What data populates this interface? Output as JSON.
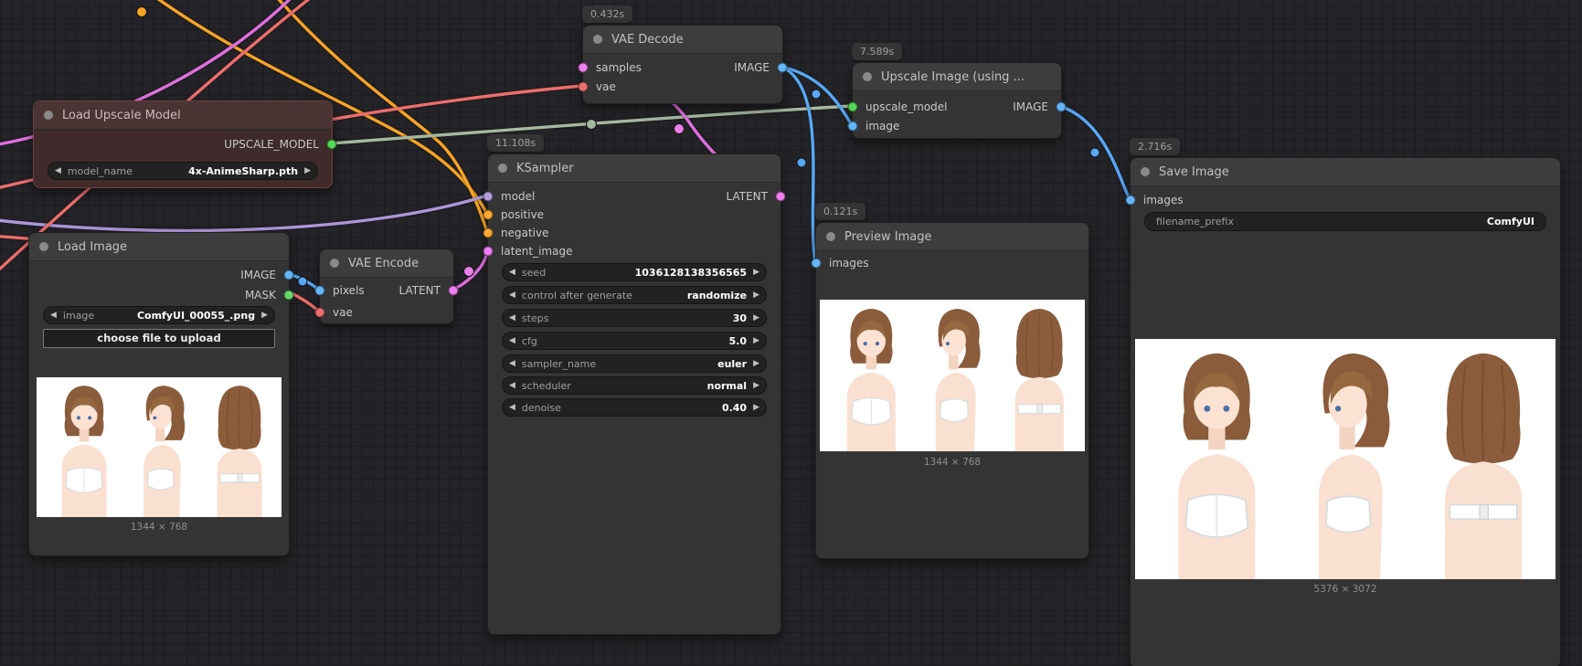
{
  "app": {
    "name": "ComfyUI",
    "view": "node-graph"
  },
  "colors": {
    "canvas_bg": "#242428",
    "grid_line": "#1d1d20",
    "node_bg": "#343434",
    "node_header_bg": "#3d3d3d",
    "red_node_bg": "#3f2b2b",
    "red_node_header_bg": "#4a3434",
    "image_link": "#64b5f6",
    "mask_link": "#66d96b",
    "latent_link": "#ee7ff1",
    "vae_link": "#ed6d6d",
    "model_link": "#b39ddb",
    "conditioning_link": "#ffa931",
    "upscale_model_dot": "#57d657",
    "upscale_model_wire": "#a6b8a1"
  },
  "nodes": {
    "load_upscale_model": {
      "title": "Load Upscale Model",
      "outputs": [
        {
          "name": "UPSCALE_MODEL"
        }
      ],
      "widgets": [
        {
          "name": "model_name",
          "value": "4x-AnimeSharp.pth"
        }
      ]
    },
    "load_image": {
      "title": "Load Image",
      "outputs": [
        {
          "name": "IMAGE"
        },
        {
          "name": "MASK"
        }
      ],
      "widgets": [
        {
          "name": "image",
          "value": "ComfyUI_00055_.png"
        }
      ],
      "button": "choose file to upload",
      "caption": "1344 × 768"
    },
    "vae_encode": {
      "title": "VAE Encode",
      "inputs": [
        {
          "name": "pixels"
        },
        {
          "name": "vae"
        }
      ],
      "outputs": [
        {
          "name": "LATENT"
        }
      ]
    },
    "ksampler": {
      "badge": "11.108s",
      "title": "KSampler",
      "inputs": [
        {
          "name": "model"
        },
        {
          "name": "positive"
        },
        {
          "name": "negative"
        },
        {
          "name": "latent_image"
        }
      ],
      "outputs": [
        {
          "name": "LATENT"
        }
      ],
      "widgets": [
        {
          "name": "seed",
          "value": "1036128138356565"
        },
        {
          "name": "control after generate",
          "value": "randomize"
        },
        {
          "name": "steps",
          "value": "30"
        },
        {
          "name": "cfg",
          "value": "5.0"
        },
        {
          "name": "sampler_name",
          "value": "euler"
        },
        {
          "name": "scheduler",
          "value": "normal"
        },
        {
          "name": "denoise",
          "value": "0.40"
        }
      ]
    },
    "vae_decode": {
      "badge": "0.432s",
      "title": "VAE Decode",
      "inputs": [
        {
          "name": "samples"
        },
        {
          "name": "vae"
        }
      ],
      "outputs": [
        {
          "name": "IMAGE"
        }
      ]
    },
    "upscale_image": {
      "badge": "7.589s",
      "title": "Upscale Image (using ...",
      "inputs": [
        {
          "name": "upscale_model"
        },
        {
          "name": "image"
        }
      ],
      "outputs": [
        {
          "name": "IMAGE"
        }
      ]
    },
    "preview_image": {
      "badge": "0.121s",
      "title": "Preview Image",
      "inputs": [
        {
          "name": "images"
        }
      ],
      "caption": "1344 × 768"
    },
    "save_image": {
      "badge": "2.716s",
      "title": "Save Image",
      "inputs": [
        {
          "name": "images"
        }
      ],
      "widgets": [
        {
          "name": "filename_prefix",
          "value": "ComfyUI"
        }
      ],
      "caption": "5376 × 3072"
    }
  }
}
